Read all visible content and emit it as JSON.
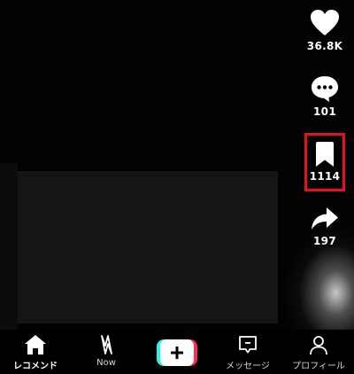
{
  "actions": {
    "like_count": "36.8K",
    "comment_count": "101",
    "save_count": "1114",
    "share_count": "197"
  },
  "nav": {
    "home_label": "レコメンド",
    "now_label": "Now",
    "inbox_label": "メッセージ",
    "profile_label": "プロフィール"
  },
  "colors": {
    "highlight": "#e0141e",
    "create_cyan": "#25f4ee",
    "create_red": "#fe2c55"
  }
}
